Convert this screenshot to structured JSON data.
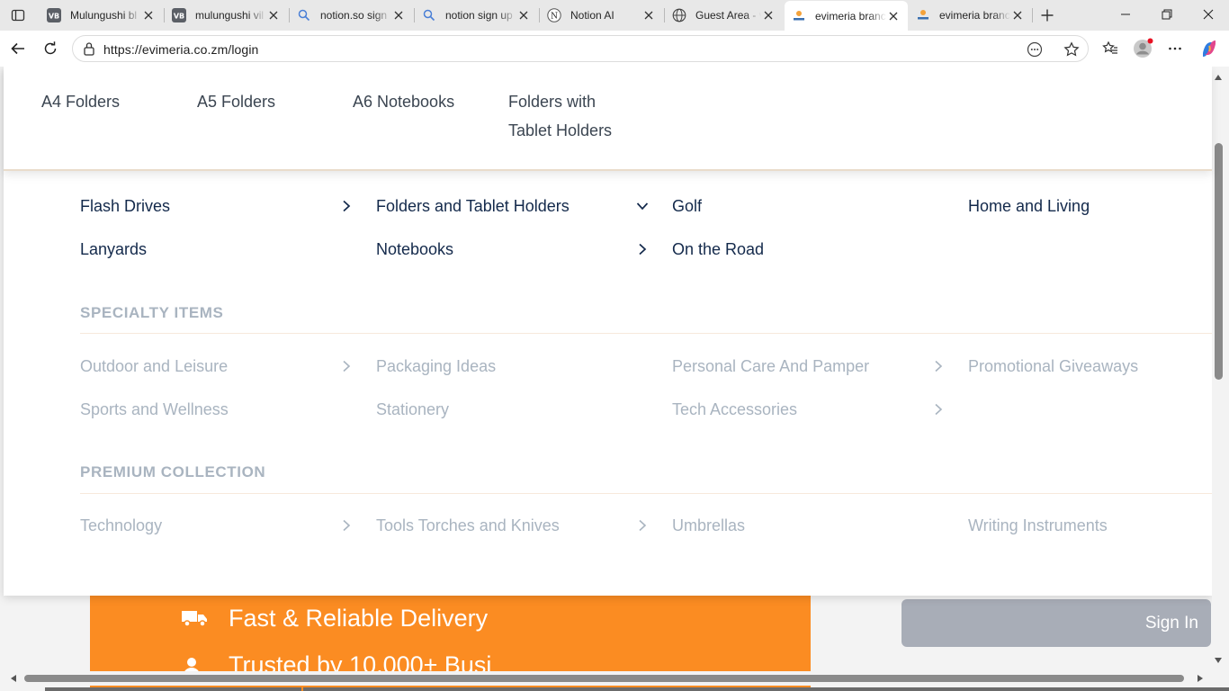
{
  "browser": {
    "tabs": [
      {
        "title": "Mulungushi bl",
        "favicon": "vb-logo-icon"
      },
      {
        "title": "mulungushi vil",
        "favicon": "vb-logo-icon"
      },
      {
        "title": "notion.so sign",
        "favicon": "search-icon"
      },
      {
        "title": "notion sign up",
        "favicon": "search-icon"
      },
      {
        "title": "Notion AI",
        "favicon": "notion-icon"
      },
      {
        "title": "Guest Area - v",
        "favicon": "globe-icon"
      },
      {
        "title": "evimeria branc",
        "favicon": "evimeria-logo-icon",
        "active": true
      },
      {
        "title": "evimeria branc",
        "favicon": "evimeria-logo-icon"
      }
    ],
    "url": "https://evimeria.co.zm/login"
  },
  "submenu": {
    "items": [
      "A4 Folders",
      "A5 Folders",
      "A6 Notebooks",
      "Folders with",
      "Tablet Holders"
    ]
  },
  "menu": {
    "main_items": [
      {
        "label": "Flash Drives",
        "chevron": "right"
      },
      {
        "label": "Folders and Tablet Holders",
        "chevron": "down"
      },
      {
        "label": "Golf"
      },
      {
        "label": "Home and Living"
      },
      {
        "label": "Lanyards"
      },
      {
        "label": "Notebooks",
        "chevron": "right"
      },
      {
        "label": "On the Road"
      }
    ],
    "specialty": {
      "title": "SPECIALTY ITEMS",
      "items": [
        {
          "label": "Outdoor and Leisure",
          "chevron": "right"
        },
        {
          "label": "Packaging Ideas"
        },
        {
          "label": "Personal Care And Pamper",
          "chevron": "right"
        },
        {
          "label": "Promotional Giveaways"
        },
        {
          "label": "Sports and Wellness"
        },
        {
          "label": "Stationery"
        },
        {
          "label": "Tech Accessories",
          "chevron": "right"
        }
      ]
    },
    "premium": {
      "title": "PREMIUM COLLECTION",
      "items": [
        {
          "label": "Technology",
          "chevron": "right"
        },
        {
          "label": "Tools Torches and Knives",
          "chevron": "right"
        },
        {
          "label": "Umbrellas"
        },
        {
          "label": "Writing Instruments"
        }
      ]
    }
  },
  "hero": {
    "delivery_text": "Fast & Reliable Delivery",
    "trusted_text": "Trusted by 10,000+ Busi"
  },
  "signin": {
    "label": "Sign In"
  },
  "colors": {
    "accent_orange": "#fb8c22",
    "menu_dark": "#13294b",
    "menu_muted": "#a9b4c0",
    "signin_bg": "#a8adb7"
  }
}
